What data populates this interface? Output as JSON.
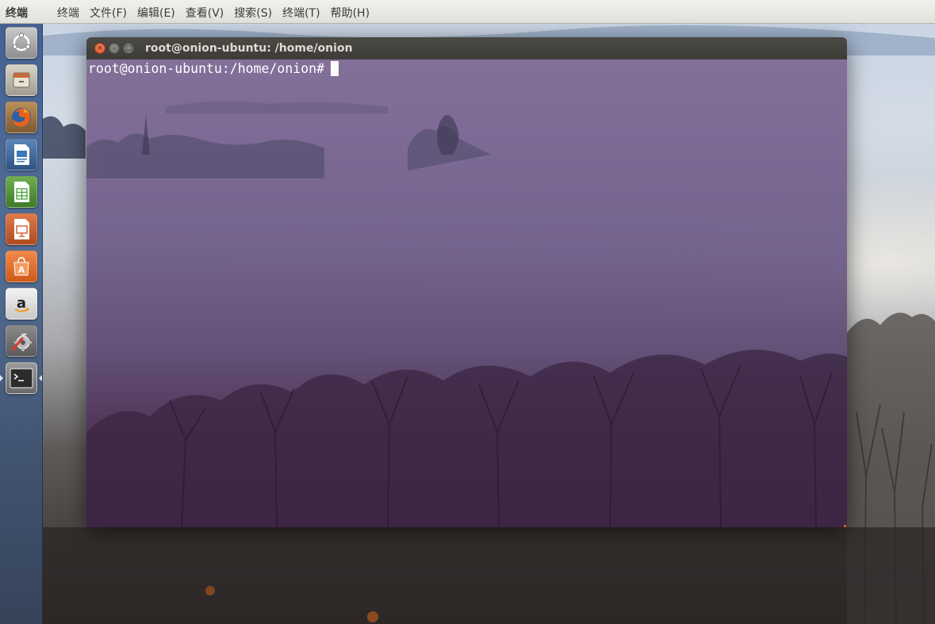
{
  "top_panel": {
    "app_title": "终端",
    "menu": [
      {
        "label": "终端"
      },
      {
        "label": "文件(F)"
      },
      {
        "label": "编辑(E)"
      },
      {
        "label": "查看(V)"
      },
      {
        "label": "搜索(S)"
      },
      {
        "label": "终端(T)"
      },
      {
        "label": "帮助(H)"
      }
    ]
  },
  "launcher": {
    "items": [
      {
        "icon": "ubuntu-dash-icon"
      },
      {
        "icon": "files-icon"
      },
      {
        "icon": "firefox-icon"
      },
      {
        "icon": "libreoffice-writer-icon"
      },
      {
        "icon": "libreoffice-calc-icon"
      },
      {
        "icon": "libreoffice-impress-icon"
      },
      {
        "icon": "software-center-icon"
      },
      {
        "icon": "amazon-icon"
      },
      {
        "icon": "system-settings-icon"
      },
      {
        "icon": "terminal-icon",
        "active": true
      }
    ]
  },
  "terminal": {
    "title": "root@onion-ubuntu: /home/onion",
    "prompt": "root@onion-ubuntu:/home/onion#",
    "buttons": {
      "close": "×",
      "minimize": "–",
      "maximize": "□"
    }
  },
  "colors": {
    "panel_bg": "#e3e1dc",
    "titlebar_bg": "#3c3b37",
    "terminal_bg": "#6e5a86",
    "close_button": "#e0512a",
    "text_light": "#ffffff"
  }
}
